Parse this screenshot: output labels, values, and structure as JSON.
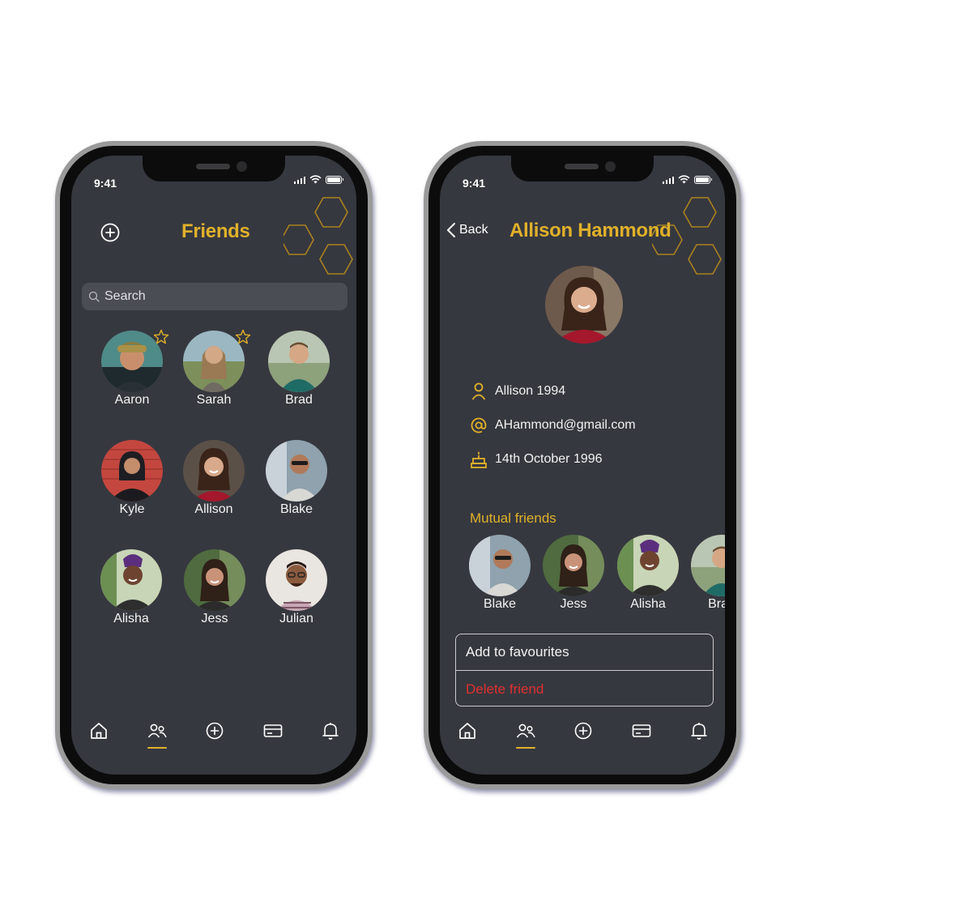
{
  "status": {
    "time": "9:41"
  },
  "friends_screen": {
    "title": "Friends",
    "search": {
      "placeholder": "Search",
      "value": ""
    },
    "friends": [
      {
        "name": "Aaron",
        "favourite": true
      },
      {
        "name": "Sarah",
        "favourite": true
      },
      {
        "name": "Brad",
        "favourite": false
      },
      {
        "name": "Kyle",
        "favourite": false
      },
      {
        "name": "Allison",
        "favourite": false
      },
      {
        "name": "Blake",
        "favourite": false
      },
      {
        "name": "Alisha",
        "favourite": false
      },
      {
        "name": "Jess",
        "favourite": false
      },
      {
        "name": "Julian",
        "favourite": false
      }
    ]
  },
  "profile_screen": {
    "back_label": "Back",
    "title": "Allison Hammond",
    "username": "Allison 1994",
    "email": "AHammond@gmail.com",
    "birthday": "14th October 1996",
    "mutual_title": "Mutual friends",
    "mutual_friends": [
      "Blake",
      "Jess",
      "Alisha",
      "Brad"
    ],
    "actions": {
      "favourite": "Add to favourites",
      "delete": "Delete friend"
    }
  },
  "nav": {
    "items": [
      "home-icon",
      "friends-icon",
      "add-circle-icon",
      "card-icon",
      "bell-icon"
    ],
    "active": "friends-icon"
  },
  "colors": {
    "accent": "#e0b12a",
    "screen_bg": "#36383f",
    "danger": "#e0302f",
    "text": "#f3f3f3"
  }
}
